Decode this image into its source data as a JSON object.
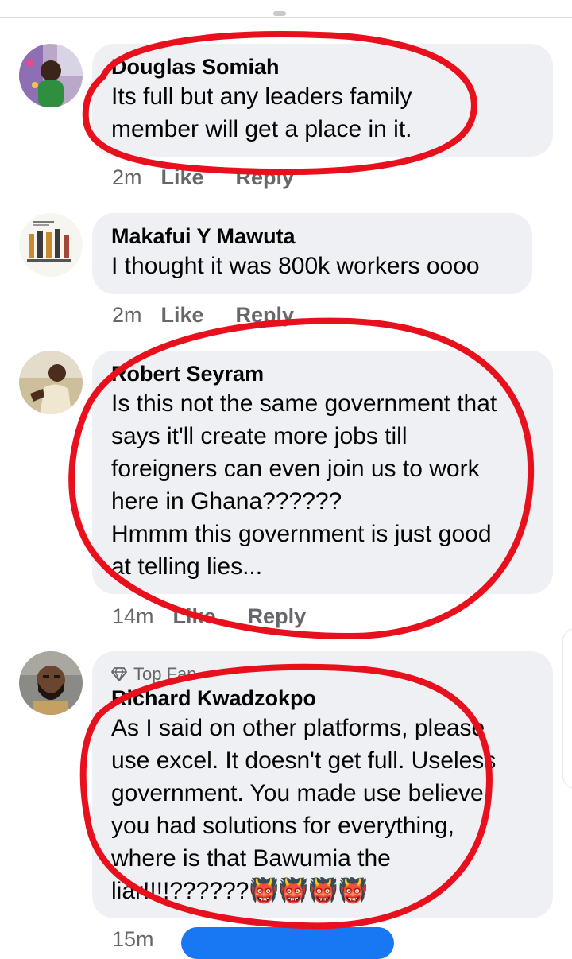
{
  "comments": [
    {
      "author": "Douglas Somiah",
      "text": "Its full but any leaders family\nmember will get a place in it.",
      "time": "2m",
      "like_label": "Like",
      "reply_label": "Reply"
    },
    {
      "author": "Makafui Y Mawuta",
      "text": "I thought it was 800k workers oooo",
      "time": "2m",
      "like_label": "Like",
      "reply_label": "Reply"
    },
    {
      "author": "Robert Seyram",
      "text": "Is this not the same government that\nsays it'll create more jobs till\nforeigners can even join us to work\nhere in Ghana??????\nHmmm this government is just good\nat telling lies...",
      "time": "14m",
      "like_label": "Like",
      "reply_label": "Reply"
    },
    {
      "badge": "Top Fan",
      "author": "Richard Kwadzokpo",
      "text": "As I said on other platforms, please\nuse excel. It doesn't get full. Useless\ngovernment. You made use believe\nyou had solutions for everything,\nwhere is that Bawumia the\nliar!!!!??????👹👹👹👹",
      "time": "15m"
    }
  ],
  "colors": {
    "bubble": "#eef0f3",
    "secondary_text": "#65676b",
    "annotation_red": "#e8101c",
    "accent_blue": "#1877f2"
  },
  "icons": {
    "top_fan_badge": "diamond-icon"
  }
}
